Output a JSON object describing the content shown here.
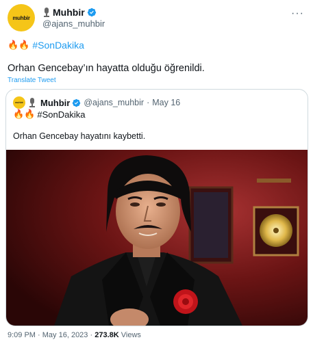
{
  "header": {
    "avatar_text": "muhbir",
    "display_name": "Muhbir",
    "handle": "@ajans_muhbir",
    "more_icon": "more-horizontal-icon"
  },
  "tweet": {
    "hashtag": "#SonDakika",
    "text": "Orhan Gencebay’ın hayatta olduğu öğrenildi.",
    "translate_label": "Translate Tweet"
  },
  "quote": {
    "display_name": "Muhbir",
    "handle": "@ajans_muhbir",
    "separator": "·",
    "date": "May 16",
    "hashtag": "#SonDakika",
    "text": "Orhan Gencebay hayatını kaybetti."
  },
  "footer": {
    "time": "9:09 PM",
    "separator1": "·",
    "date": "May 16, 2023",
    "separator2": "·",
    "views_count": "273.8K",
    "views_label": "Views"
  },
  "colors": {
    "accent": "#1d9bf0",
    "avatar_bg": "#f5c518",
    "secondary_text": "#536471"
  }
}
